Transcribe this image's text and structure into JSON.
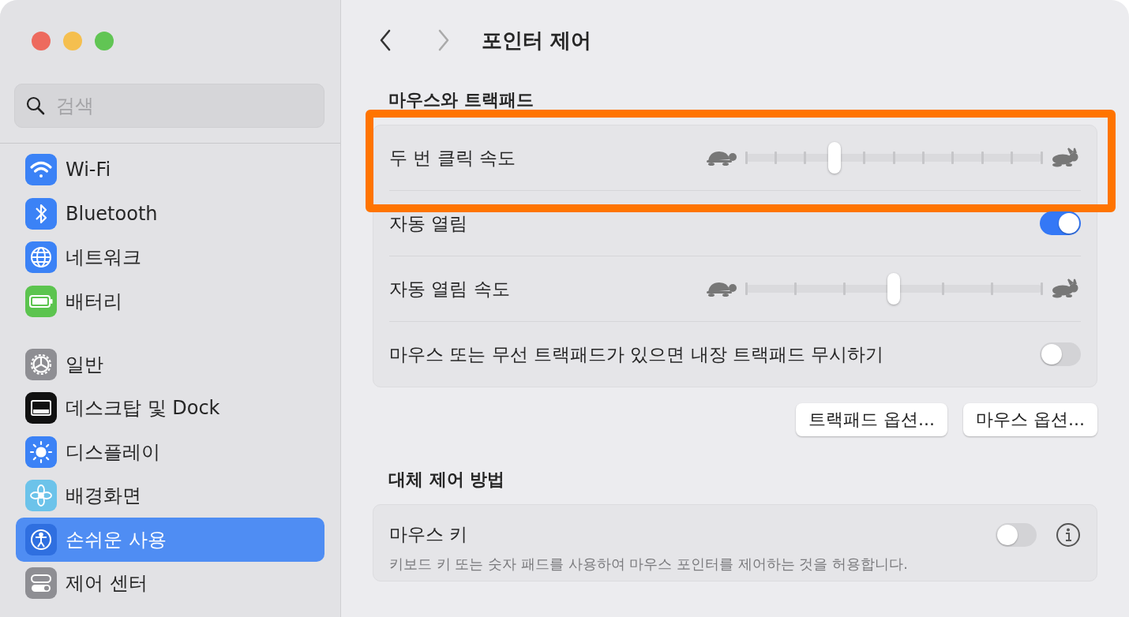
{
  "sidebar": {
    "search": {
      "placeholder": "검색"
    },
    "groups": [
      [
        {
          "label": "Wi-Fi",
          "selected": false
        },
        {
          "label": "Bluetooth",
          "selected": false
        },
        {
          "label": "네트워크",
          "selected": false
        },
        {
          "label": "배터리",
          "selected": false
        }
      ],
      [
        {
          "label": "일반",
          "selected": false
        },
        {
          "label": "데스크탑 및 Dock",
          "selected": false
        },
        {
          "label": "디스플레이",
          "selected": false
        },
        {
          "label": "배경화면",
          "selected": false
        },
        {
          "label": "손쉬운 사용",
          "selected": true
        },
        {
          "label": "제어 센터",
          "selected": false
        }
      ]
    ]
  },
  "header": {
    "title": "포인터 제어"
  },
  "sections": [
    {
      "title": "마우스와 트랙패드",
      "rows": [
        {
          "kind": "slider",
          "label": "두 번 클릭 속도",
          "level": 0.3,
          "highlighted": true
        },
        {
          "kind": "toggle",
          "label": "자동 열림",
          "on": true
        },
        {
          "kind": "slider",
          "label": "자동 열림 속도",
          "level": 0.5,
          "highlighted": false
        },
        {
          "kind": "toggle",
          "label": "마우스 또는 무선 트랙패드가 있으면 내장 트랙패드 무시하기",
          "on": false
        }
      ],
      "buttons": [
        "트랙패드 옵션...",
        "마우스 옵션..."
      ]
    },
    {
      "title": "대체 제어 방법",
      "rows": [
        {
          "kind": "toggle",
          "label": "마우스 키",
          "description": "키보드 키 또는 숫자 패드를 사용하여 마우스 포인터를 제어하는 것을 허용합니다.",
          "on": false,
          "info": true
        }
      ]
    }
  ]
}
